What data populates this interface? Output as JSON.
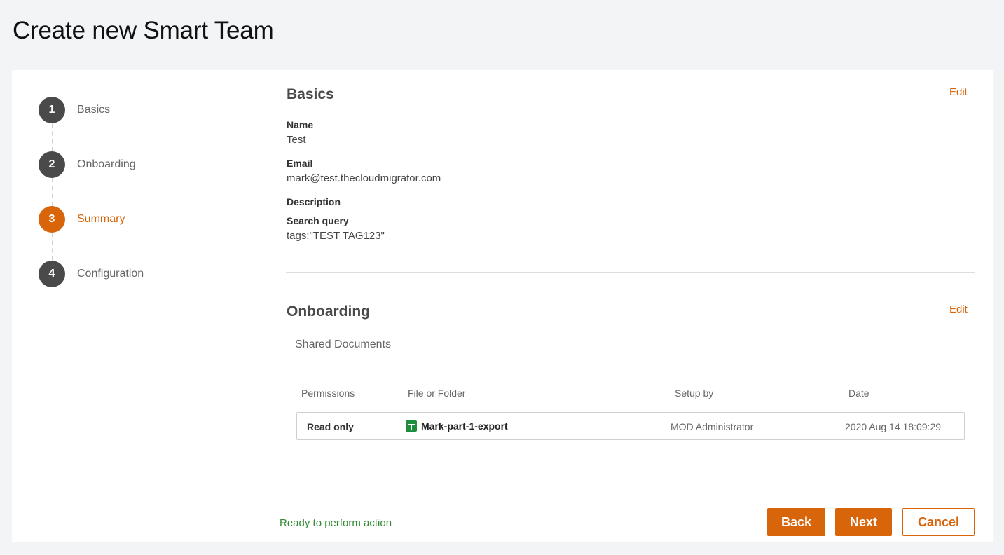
{
  "page": {
    "title": "Create new Smart Team"
  },
  "stepper": {
    "steps": [
      {
        "number": "1",
        "label": "Basics",
        "state": "done"
      },
      {
        "number": "2",
        "label": "Onboarding",
        "state": "done"
      },
      {
        "number": "3",
        "label": "Summary",
        "state": "active"
      },
      {
        "number": "4",
        "label": "Configuration",
        "state": "pending"
      }
    ]
  },
  "basics": {
    "title": "Basics",
    "edit_label": "Edit",
    "name_label": "Name",
    "name_value": "Test",
    "email_label": "Email",
    "email_value": "mark@test.thecloudmigrator.com",
    "description_label": "Description",
    "query_label": "Search query",
    "query_value": "tags:\"TEST TAG123\""
  },
  "onboarding": {
    "title": "Onboarding",
    "edit_label": "Edit",
    "subsection": "Shared Documents",
    "columns": [
      "Permissions",
      "File or Folder",
      "Setup by",
      "Date"
    ],
    "rows": [
      {
        "permission": "Read only",
        "file": "Mark-part-1-export",
        "file_icon": "google-sheets-icon",
        "setup_by": "MOD Administrator",
        "date": "2020 Aug 14 18:09:29"
      }
    ]
  },
  "footer": {
    "status": "Ready to perform action",
    "back_label": "Back",
    "next_label": "Next",
    "cancel_label": "Cancel"
  },
  "colors": {
    "accent": "#d9650b",
    "step_inactive": "#4a4a4a",
    "status_ok": "#2e8b2e",
    "sheet_icon": "#1e8e3e"
  }
}
